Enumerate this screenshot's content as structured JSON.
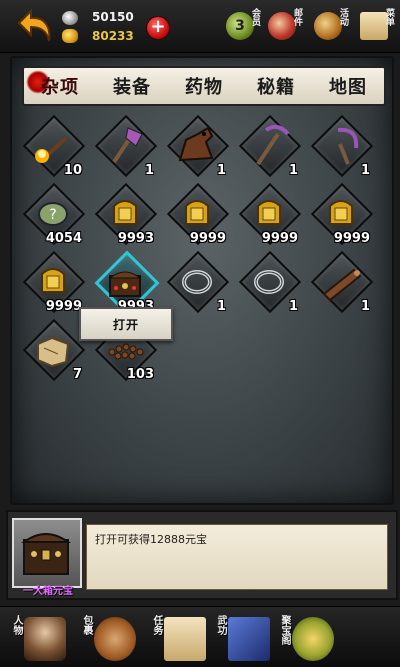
{
  "topbar": {
    "silver": "50150",
    "gold": "80233",
    "icons": [
      {
        "name": "vip",
        "label": "会员",
        "badge": "3"
      },
      {
        "name": "mail",
        "label": "邮件"
      },
      {
        "name": "activity",
        "label": "活动"
      },
      {
        "name": "menu",
        "label": "菜单"
      }
    ]
  },
  "tabs": [
    {
      "label": "杂项",
      "active": true
    },
    {
      "label": "装备",
      "active": false
    },
    {
      "label": "药物",
      "active": false
    },
    {
      "label": "秘籍",
      "active": false
    },
    {
      "label": "地图",
      "active": false
    }
  ],
  "items": [
    {
      "icon": "torch-icon",
      "qty": "10"
    },
    {
      "icon": "axe-icon",
      "qty": "1"
    },
    {
      "icon": "horse-icon",
      "qty": "1"
    },
    {
      "icon": "pickaxe-icon",
      "qty": "1"
    },
    {
      "icon": "sickle-icon",
      "qty": "1"
    },
    {
      "icon": "question-stone-icon",
      "qty": "4054"
    },
    {
      "icon": "gold-tablet-icon",
      "qty": "9993"
    },
    {
      "icon": "gold-tablet-icon",
      "qty": "9999"
    },
    {
      "icon": "gold-tablet-icon",
      "qty": "9999"
    },
    {
      "icon": "gold-tablet-icon",
      "qty": "9999"
    },
    {
      "icon": "gold-tablet-icon",
      "qty": "9999"
    },
    {
      "icon": "treasure-chest-icon",
      "qty": "9993",
      "selected": true
    },
    {
      "icon": "iron-ring-icon",
      "qty": "1"
    },
    {
      "icon": "iron-ring-icon",
      "qty": "1"
    },
    {
      "icon": "wood-log-icon",
      "qty": "1"
    },
    {
      "icon": "map-scroll-icon",
      "qty": "7"
    },
    {
      "icon": "beads-icon",
      "qty": "103"
    }
  ],
  "popup": {
    "open_label": "打开"
  },
  "info": {
    "item_name": "一大箱元宝",
    "description": "打开可获得12888元宝"
  },
  "bottomnav": [
    {
      "label": "人物",
      "icon": "character-icon"
    },
    {
      "label": "包裹",
      "icon": "bag-icon"
    },
    {
      "label": "任务",
      "icon": "scroll-icon"
    },
    {
      "label": "武功",
      "icon": "book-icon"
    },
    {
      "label": "聚宝阁",
      "icon": "treasure-icon"
    }
  ]
}
